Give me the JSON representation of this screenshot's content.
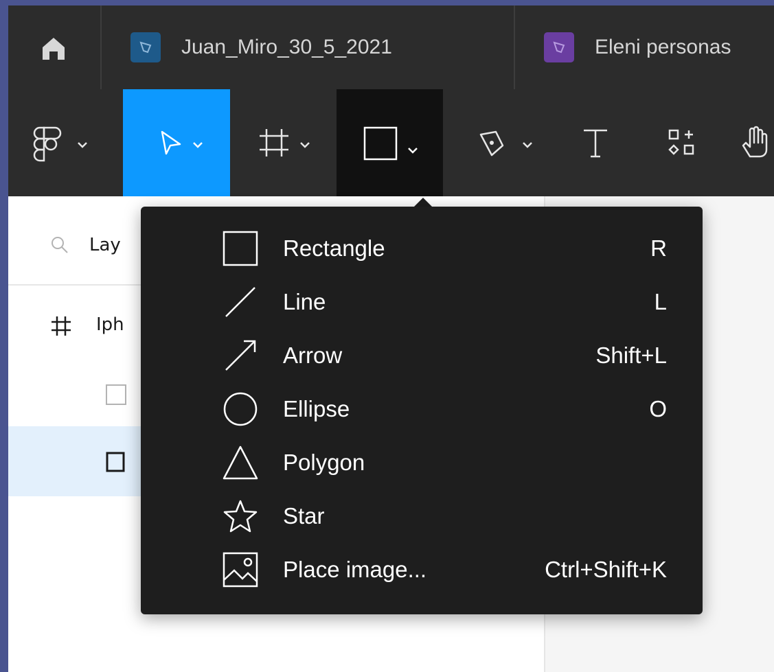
{
  "tabs": [
    {
      "label": "Juan_Miro_30_5_2021",
      "color": "#1e5a8a"
    },
    {
      "label": "Eleni personas",
      "color": "#6a3ea1"
    }
  ],
  "toolbar": {
    "active_color": "#0d99ff",
    "tools": [
      "main-menu",
      "move-tool",
      "frame-tool",
      "shape-tools",
      "pen-tool",
      "text-tool",
      "resources",
      "hand-tool"
    ]
  },
  "layers": {
    "search_placeholder": "Lay",
    "frame_name": "Iph"
  },
  "shape_menu": {
    "items": [
      {
        "label": "Rectangle",
        "shortcut": "R",
        "icon": "rectangle-icon"
      },
      {
        "label": "Line",
        "shortcut": "L",
        "icon": "line-icon"
      },
      {
        "label": "Arrow",
        "shortcut": "Shift+L",
        "icon": "arrow-icon"
      },
      {
        "label": "Ellipse",
        "shortcut": "O",
        "icon": "ellipse-icon"
      },
      {
        "label": "Polygon",
        "shortcut": "",
        "icon": "polygon-icon"
      },
      {
        "label": "Star",
        "shortcut": "",
        "icon": "star-icon"
      },
      {
        "label": "Place image...",
        "shortcut": "Ctrl+Shift+K",
        "icon": "image-icon"
      }
    ]
  }
}
